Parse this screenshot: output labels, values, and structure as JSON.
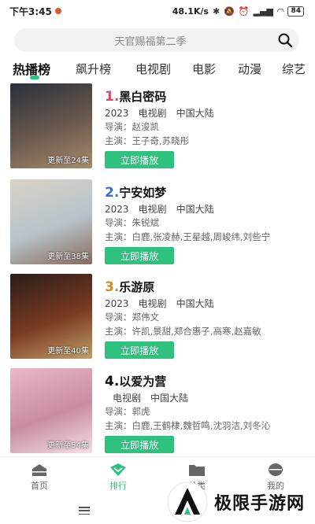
{
  "status": {
    "time": "下午3:45",
    "speed": "48.1K/s",
    "battery": "84"
  },
  "search": {
    "placeholder": "天官赐福第二季"
  },
  "tabs": [
    "热播榜",
    "飙升榜",
    "电视剧",
    "电影",
    "动漫",
    "综艺"
  ],
  "items": [
    {
      "rank": "1.",
      "name": "黑白密码",
      "year": "",
      "meta": [
        "2023",
        "电视剧",
        "中国大陆"
      ],
      "director": "导演：赵浚凯",
      "cast": "主演：王子奇,苏晓彤",
      "update": "更新至24集",
      "play": "立即播放",
      "colors": [
        "#2b2f3a",
        "#6b5a4e",
        "#a88c6c"
      ]
    },
    {
      "rank": "2.",
      "name": "宁安如梦",
      "meta": [
        "2023",
        "电视剧",
        "中国大陆"
      ],
      "director": "导演：朱锐斌",
      "cast": "主演：白鹿,张凌赫,王星越,周峻纬,刘些宁",
      "update": "更新至38集",
      "play": "立即播放",
      "colors": [
        "#d9d2c8",
        "#b7c3c9",
        "#8a6a5c"
      ]
    },
    {
      "rank": "3.",
      "name": "乐游原",
      "meta": [
        "2023",
        "电视剧",
        "中国大陆"
      ],
      "director": "导演：郑伟文",
      "cast": "主演：许凯,景甜,郑合惠子,高寒,赵嘉敏",
      "update": "更新至40集",
      "play": "立即播放",
      "colors": [
        "#2a1d18",
        "#7a3a22",
        "#c2a06a"
      ]
    },
    {
      "rank": "4.",
      "name": "以爱为营",
      "meta": [
        "电视剧",
        "中国大陆"
      ],
      "director": "导演：郭虎",
      "cast": "主演：白鹿,王鹤棣,魏哲鸣,沈羽洁,刘冬沁",
      "update": "更新至54集",
      "play": "立即播放",
      "colors": [
        "#e9b8c6",
        "#c98da0",
        "#f3e0e6"
      ]
    }
  ],
  "rank_colors": [
    "#d94a6a",
    "#3f6fd6",
    "#d98a2b",
    "#111111"
  ],
  "bottom_nav": [
    {
      "label": "首页",
      "icon": "home-icon"
    },
    {
      "label": "排行",
      "icon": "ranking-icon"
    },
    {
      "label": "分类",
      "icon": "folder-icon"
    },
    {
      "label": "我的",
      "icon": "profile-icon"
    }
  ],
  "watermark": {
    "text": "极限手游网"
  },
  "accent": "#2ec27e"
}
